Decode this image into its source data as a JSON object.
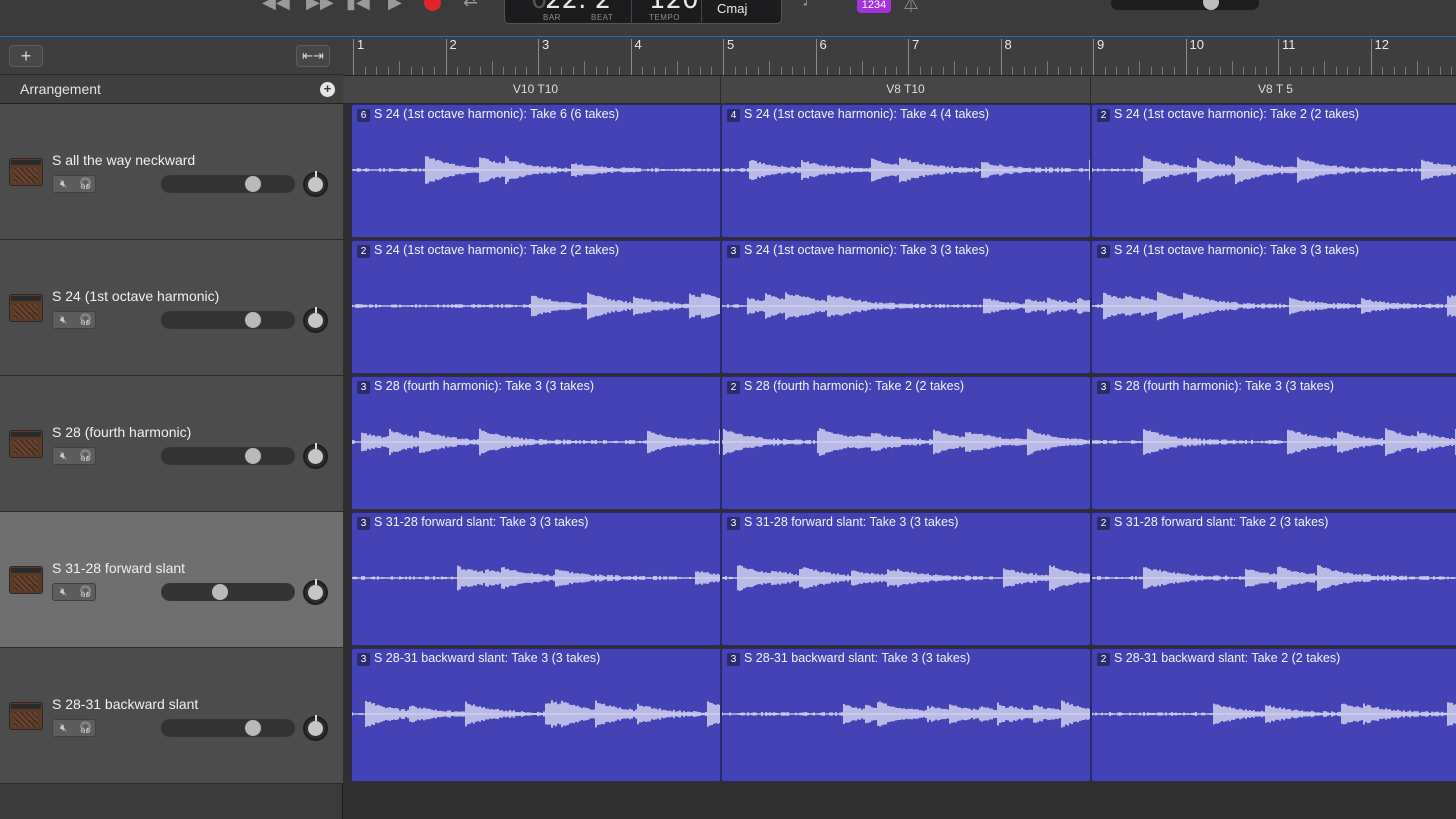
{
  "transport": {
    "icons": [
      "rewind-icon",
      "fast-forward-icon",
      "skip-back-icon",
      "play-icon",
      "record-icon",
      "cycle-icon"
    ],
    "lcd": {
      "position": "22. 2",
      "bar_label": "BAR",
      "beat_label": "BEAT",
      "tempo": "120",
      "tempo_label": "TEMPO",
      "key": "Cmaj"
    },
    "count_in_badge": "1234"
  },
  "header": {
    "add_track_symbol": "+",
    "arrangement_label": "Arrangement",
    "arrangement_add_symbol": "+"
  },
  "ruler": {
    "bars": [
      "1",
      "2",
      "3",
      "4",
      "5",
      "6",
      "7",
      "8",
      "9",
      "10",
      "11",
      "12"
    ]
  },
  "arrangement_markers": [
    "V10 T10",
    "V8 T10",
    "V8 T 5"
  ],
  "tracks": [
    {
      "name": "S all the way neckward",
      "volume": 0.72,
      "selected": false,
      "regions": [
        {
          "takes": "6",
          "title": "S 24 (1st octave harmonic): Take 6 (6 takes)"
        },
        {
          "takes": "4",
          "title": "S 24 (1st octave harmonic): Take 4 (4 takes)"
        },
        {
          "takes": "2",
          "title": "S 24 (1st octave harmonic): Take 2 (2 takes)"
        }
      ]
    },
    {
      "name": "S 24 (1st octave harmonic)",
      "volume": 0.72,
      "selected": false,
      "regions": [
        {
          "takes": "2",
          "title": "S 24 (1st octave harmonic): Take 2 (2 takes)"
        },
        {
          "takes": "3",
          "title": "S 24 (1st octave harmonic): Take 3 (3 takes)"
        },
        {
          "takes": "3",
          "title": "S 24 (1st octave harmonic): Take 3 (3 takes)"
        }
      ]
    },
    {
      "name": "S 28 (fourth harmonic)",
      "volume": 0.72,
      "selected": false,
      "regions": [
        {
          "takes": "3",
          "title": "S 28 (fourth harmonic): Take 3 (3 takes)"
        },
        {
          "takes": "2",
          "title": "S 28 (fourth harmonic): Take 2 (2 takes)"
        },
        {
          "takes": "3",
          "title": "S 28 (fourth harmonic): Take 3 (3 takes)"
        }
      ]
    },
    {
      "name": "S 31-28 forward slant",
      "volume": 0.44,
      "selected": true,
      "regions": [
        {
          "takes": "3",
          "title": "S 31-28 forward slant: Take 3 (3 takes)"
        },
        {
          "takes": "3",
          "title": "S 31-28 forward slant: Take 3 (3 takes)"
        },
        {
          "takes": "2",
          "title": "S 31-28 forward slant: Take 2 (3 takes)"
        }
      ]
    },
    {
      "name": "S 28-31 backward slant",
      "volume": 0.72,
      "selected": false,
      "regions": [
        {
          "takes": "3",
          "title": "S 28-31 backward slant: Take 3 (3 takes)"
        },
        {
          "takes": "3",
          "title": "S 28-31 backward slant: Take 3 (3 takes)"
        },
        {
          "takes": "2",
          "title": "S 28-31 backward slant: Take 2 (2 takes)"
        }
      ]
    }
  ],
  "colors": {
    "region": "#4343b5",
    "waveform": "#d8d8f2",
    "record": "#e0242a",
    "accent": "#1f6fb7"
  }
}
